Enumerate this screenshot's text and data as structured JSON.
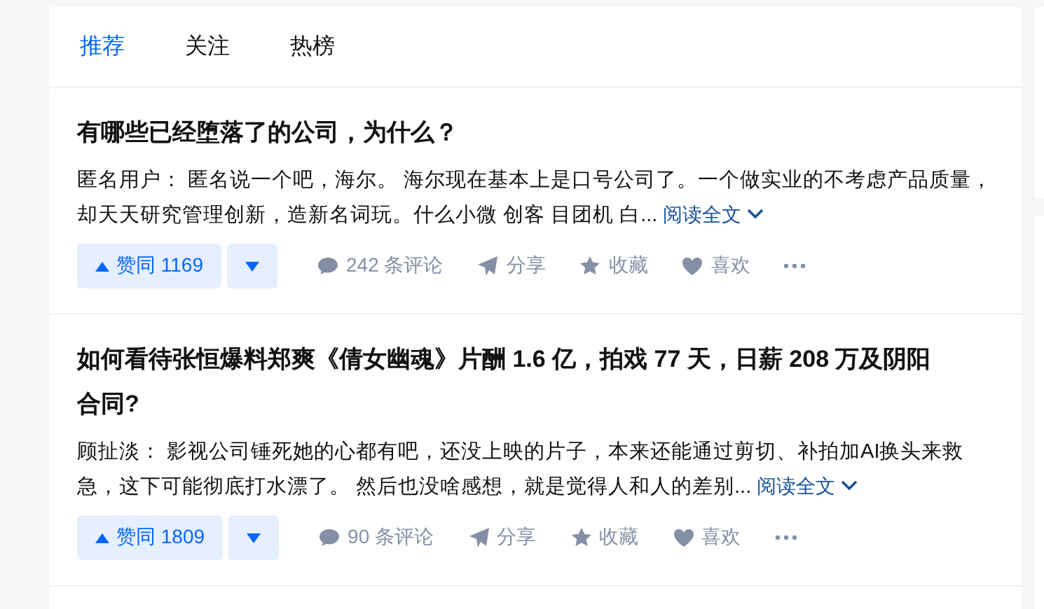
{
  "tabs": [
    {
      "label": "推荐",
      "selected": true
    },
    {
      "label": "关注",
      "selected": false
    },
    {
      "label": "热榜",
      "selected": false
    }
  ],
  "feed": [
    {
      "title": "有哪些已经堕落了的公司，为什么？",
      "excerpt": "匿名用户： 匿名说一个吧，海尔。 海尔现在基本上是口号公司了。一个做实业的不考虑产品质量，却天天研究管理创新，造新名词玩。什么小微 创客 目团机 白...",
      "read_more": "阅读全文",
      "upvote": "赞同 1169",
      "comments": "242 条评论",
      "share": "分享",
      "collect": "收藏",
      "like": "喜欢"
    },
    {
      "title": "如何看待张恒爆料郑爽《倩女幽魂》片酬 1.6 亿，拍戏 77 天，日薪 208 万及阴阳合同?",
      "excerpt": "顾扯淡： 影视公司锤死她的心都有吧，还没上映的片子，本来还能通过剪切、补拍加AI换头来救急，这下可能彻底打水漂了。 然后也没啥感想，就是觉得人和人的差别...",
      "read_more": "阅读全文",
      "upvote": "赞同 1809",
      "comments": "90 条评论",
      "share": "分享",
      "collect": "收藏",
      "like": "喜欢"
    }
  ]
}
